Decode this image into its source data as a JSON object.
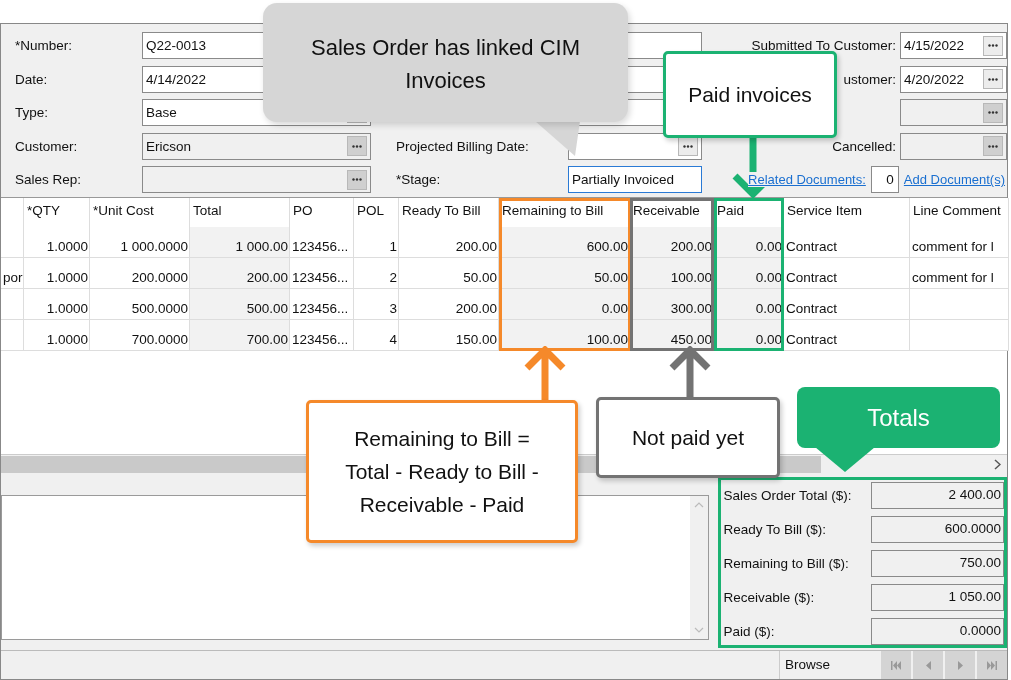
{
  "form": {
    "left_fields": [
      {
        "label": "*Number:",
        "value": "Q22-0013",
        "disabled": false
      },
      {
        "label": "Date:",
        "value": "4/14/2022",
        "disabled": false
      },
      {
        "label": "Type:",
        "value": "Base",
        "button": true,
        "disabled": false
      },
      {
        "label": "Customer:",
        "value": "Ericson",
        "button": true,
        "disabled": true
      },
      {
        "label": "Sales Rep:",
        "button": true,
        "disabled": true
      }
    ],
    "middle_fields": [
      {
        "disabled": false
      },
      {
        "disabled": false
      },
      {
        "disabled": false
      },
      {
        "label": "Projected Billing Date:",
        "button": true,
        "disabled": false
      },
      {
        "label": "*Stage:",
        "value": "Partially Invoiced",
        "button": false,
        "disabled": false,
        "focused": true
      }
    ],
    "right_fields": [
      {
        "label": "Submitted To Customer:",
        "value": "4/15/2022",
        "button": true,
        "disabled": false
      },
      {
        "label": "ustomer:",
        "value": "4/20/2022",
        "button": true,
        "disabled": false
      },
      {
        "button": true,
        "disabled": true
      },
      {
        "label": "Cancelled:",
        "button": true,
        "disabled": true
      }
    ],
    "related_documents": {
      "label": "Related Documents:",
      "count": "0",
      "add_link": "Add Document(s)"
    }
  },
  "grid": {
    "columns": [
      {
        "readonly": false
      },
      {
        "label": "*QTY",
        "readonly": false
      },
      {
        "label": "*Unit Cost",
        "readonly": false
      },
      {
        "label": "Total",
        "readonly": true
      },
      {
        "label": "PO",
        "readonly": false
      },
      {
        "label": "POL",
        "readonly": false
      },
      {
        "label": "Ready To Bill",
        "readonly": false
      },
      {
        "label": "Remaining to Bill",
        "readonly": true,
        "color": "#f5892a"
      },
      {
        "label": "Receivable",
        "readonly": true,
        "color": "#737373"
      },
      {
        "label": "Paid",
        "readonly": true,
        "color": "#1bb272"
      },
      {
        "label": "Service Item",
        "readonly": false
      },
      {
        "label": "Line Comment",
        "readonly": false
      }
    ],
    "rows": [
      [
        null,
        "1.0000",
        "1 000.0000",
        "1 000.00",
        "123456...",
        "1",
        "200.00",
        "600.00",
        "200.00",
        "0.00",
        "Contract",
        "comment for l"
      ],
      [
        "por",
        "1.0000",
        "200.0000",
        "200.00",
        "123456...",
        "2",
        "50.00",
        "50.00",
        "100.00",
        "0.00",
        "Contract",
        "comment for l"
      ],
      [
        null,
        "1.0000",
        "500.0000",
        "500.00",
        "123456...",
        "3",
        "200.00",
        "0.00",
        "300.00",
        "0.00",
        "Contract",
        null
      ],
      [
        null,
        "1.0000",
        "700.0000",
        "700.00",
        "123456...",
        "4",
        "150.00",
        "100.00",
        "450.00",
        "0.00",
        "Contract",
        null
      ]
    ]
  },
  "totals": [
    {
      "label": "Sales Order Total ($):",
      "value": "2 400.00"
    },
    {
      "label": "Ready To Bill ($):",
      "value": "600.0000"
    },
    {
      "label": "Remaining to Bill ($):",
      "value": "750.00"
    },
    {
      "label": "Receivable ($):",
      "value": "1 050.00"
    },
    {
      "label": "Paid ($):",
      "value": "0.0000"
    }
  ],
  "status_bar": {
    "mode": "Browse",
    "navigation_disabled": true
  },
  "callouts": [
    {
      "kind": "speech",
      "text": "Sales Order has linked CIM Invoices"
    },
    {
      "kind": "box",
      "text": "Paid invoices",
      "color": "#1bb272"
    },
    {
      "kind": "box",
      "text": "Remaining to Bill = Total - Ready to Bill - Receivable - Paid",
      "color": "#f5892a"
    },
    {
      "kind": "box",
      "text": "Not paid yet",
      "color": "#737373"
    },
    {
      "kind": "filled",
      "text": "Totals",
      "color": "#1bb272"
    }
  ]
}
